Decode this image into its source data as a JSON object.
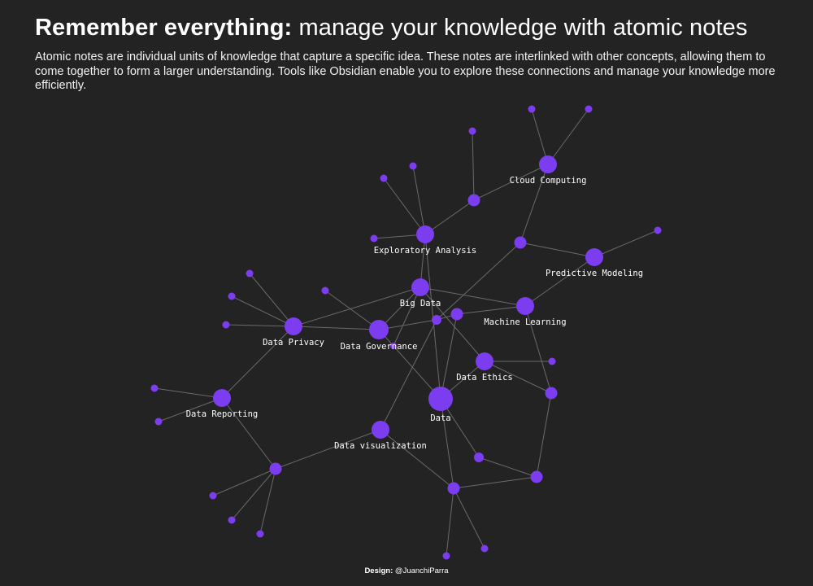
{
  "header": {
    "title_bold": "Remember everything:",
    "title_rest": "manage your knowledge with atomic notes",
    "description": "Atomic notes are individual units of knowledge that capture a specific idea. These notes are interlinked with other concepts, allowing them to come together to form a larger understanding. Tools like Obsidian enable you to explore these connections and manage your knowledge more efficiently."
  },
  "graph": {
    "node_color": "#7c3cf0",
    "edge_color": "#6a6a6a",
    "labeled_nodes": [
      {
        "id": "cloud",
        "label": "Cloud Computing"
      },
      {
        "id": "exploratory",
        "label": "Exploratory Analysis"
      },
      {
        "id": "predictive",
        "label": "Predictive Modeling"
      },
      {
        "id": "bigdata",
        "label": "Big Data"
      },
      {
        "id": "ml",
        "label": "Machine Learning"
      },
      {
        "id": "privacy",
        "label": "Data Privacy"
      },
      {
        "id": "governance",
        "label": "Data Governance"
      },
      {
        "id": "ethics",
        "label": "Data Ethics"
      },
      {
        "id": "reporting",
        "label": "Data Reporting"
      },
      {
        "id": "data",
        "label": "Data"
      },
      {
        "id": "visualization",
        "label": "Data visualization"
      }
    ]
  },
  "footer": {
    "credit_label": "Design:",
    "credit_handle": "@JuanchiParra"
  }
}
